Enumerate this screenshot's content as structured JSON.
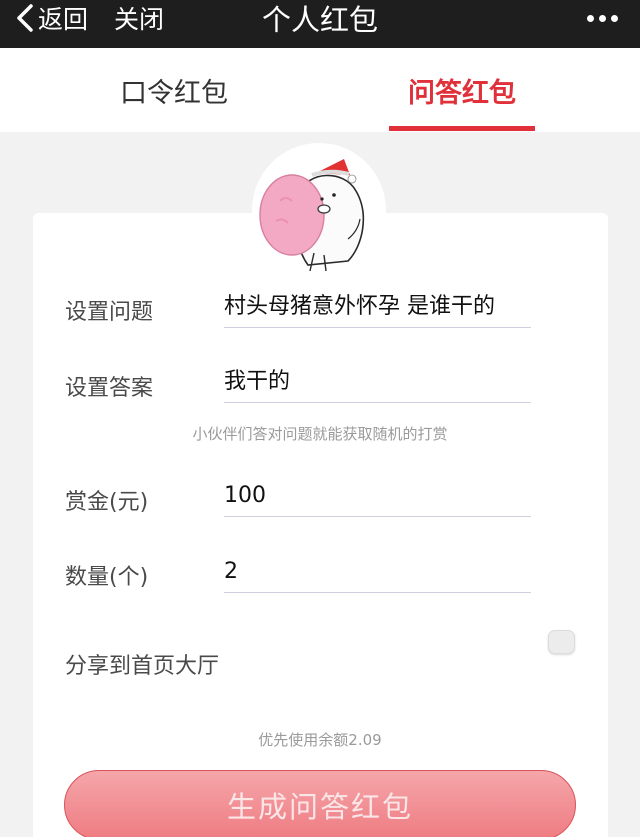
{
  "navbar": {
    "back_label": "返回",
    "close_label": "关闭",
    "title": "个人红包",
    "more_icon": "more-dots-icon",
    "bg_color": "#1e1e1e"
  },
  "tabs": [
    {
      "label": "口令红包",
      "active": false
    },
    {
      "label": "问答红包",
      "active": true
    }
  ],
  "accent_color": "#e0313a",
  "avatar": {
    "icon": "cartoon-pig-santa-hat-avatar"
  },
  "form": {
    "question": {
      "label": "设置问题",
      "value": "村头母猪意外怀孕 是谁干的"
    },
    "answer": {
      "label": "设置答案",
      "value": "我干的"
    },
    "answer_hint": "小伙伴们答对问题就能获取随机的打赏",
    "reward": {
      "label": "赏金(元)",
      "value": "100"
    },
    "quantity": {
      "label": "数量(个)",
      "value": "2"
    },
    "share": {
      "label": "分享到首页大厅",
      "enabled": false
    },
    "balance_note": "优先使用余额2.09",
    "submit_label": "生成问答红包"
  }
}
